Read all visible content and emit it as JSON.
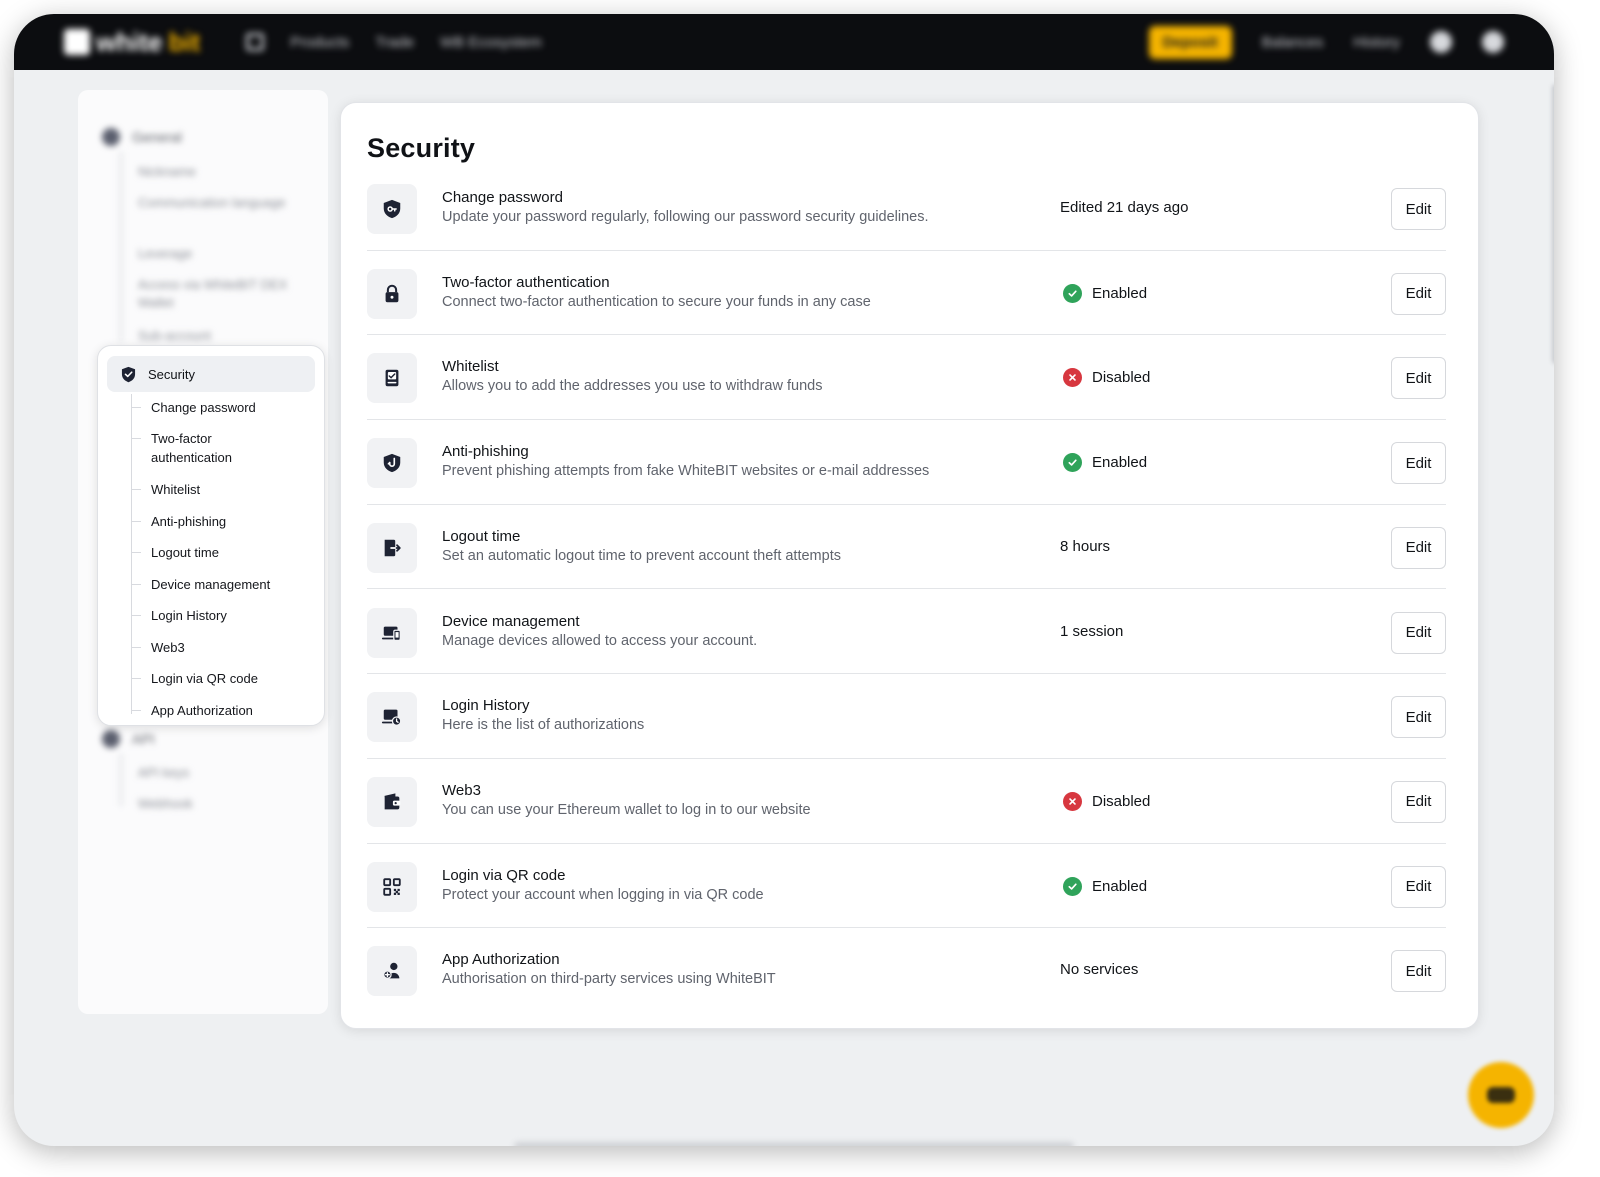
{
  "navbar": {
    "logo_text": "white",
    "logo_accent": "bit",
    "links": [
      "Products",
      "Trade",
      "WB Ecosystem"
    ],
    "deposit_label": "Deposit",
    "balances_label": "Balances",
    "history_label": "History"
  },
  "sidebar": {
    "general_label": "General",
    "general_items": [
      "Nickname",
      "Communication language",
      "Leverage",
      "Access via WhiteBIT DEX Wallet",
      "Sub-account"
    ],
    "security_label": "Security",
    "security_items": [
      "Change password",
      "Two-factor authentication",
      "Whitelist",
      "Anti-phishing",
      "Logout time",
      "Device management",
      "Login History",
      "Web3",
      "Login via QR code",
      "App Authorization"
    ],
    "api_label": "API",
    "api_items": [
      "API keys",
      "Webhook"
    ]
  },
  "main": {
    "title": "Security",
    "edit_label": "Edit",
    "rows": [
      {
        "title": "Change password",
        "desc": "Update your password regularly, following our password security guidelines.",
        "status": "Edited 21 days ago",
        "state": "text",
        "icon": "shield-key-icon"
      },
      {
        "title": "Two-factor authentication",
        "desc": "Connect two-factor authentication to secure your funds in any case",
        "status": "Enabled",
        "state": "enabled",
        "icon": "lock-icon"
      },
      {
        "title": "Whitelist",
        "desc": "Allows you to add the addresses you use to withdraw funds",
        "status": "Disabled",
        "state": "disabled",
        "icon": "whitelist-icon"
      },
      {
        "title": "Anti-phishing",
        "desc": "Prevent phishing attempts from fake WhiteBIT websites or e-mail addresses",
        "status": "Enabled",
        "state": "enabled",
        "icon": "anti-phishing-icon"
      },
      {
        "title": "Logout time",
        "desc": "Set an automatic logout time to prevent account theft attempts",
        "status": "8 hours",
        "state": "text",
        "icon": "logout-icon"
      },
      {
        "title": "Device management",
        "desc": "Manage devices allowed to access your account.",
        "status": "1 session",
        "state": "text",
        "icon": "devices-icon"
      },
      {
        "title": "Login History",
        "desc": "Here is the list of authorizations",
        "status": "",
        "state": "text",
        "icon": "login-history-icon"
      },
      {
        "title": "Web3",
        "desc": "You can use your Ethereum wallet to log in to our website",
        "status": "Disabled",
        "state": "disabled",
        "icon": "wallet-icon"
      },
      {
        "title": "Login via QR code",
        "desc": "Protect your account when logging in via QR code",
        "status": "Enabled",
        "state": "enabled",
        "icon": "qr-code-icon"
      },
      {
        "title": "App Authorization",
        "desc": "Authorisation on third-party services using WhiteBIT",
        "status": "No services",
        "state": "text",
        "icon": "user-add-icon"
      }
    ]
  },
  "colors": {
    "accent": "#f5b400",
    "enabled": "#2fa35a",
    "disabled": "#d7373f",
    "navbar": "#0c0d10"
  }
}
